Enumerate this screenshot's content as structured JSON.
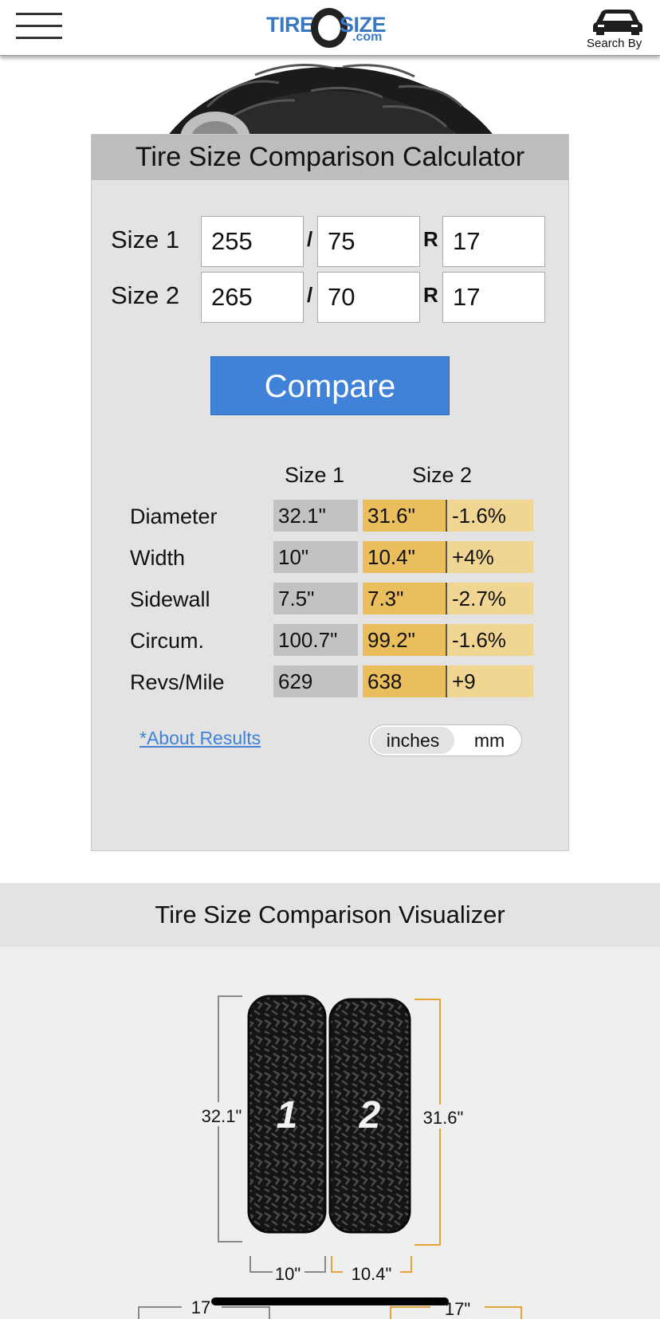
{
  "header": {
    "logo": {
      "text_main_a": "TIRE",
      "text_main_b": "SIZE",
      "text_sub": ".com"
    },
    "search_by_label": "Search By"
  },
  "calculator": {
    "title": "Tire Size Comparison Calculator",
    "size1": {
      "label": "Size 1",
      "width": "255",
      "aspect": "75",
      "rim": "17"
    },
    "size2": {
      "label": "Size 2",
      "width": "265",
      "aspect": "70",
      "rim": "17"
    },
    "separator_slash": "/",
    "separator_r": "R",
    "compare_label": "Compare",
    "columns": {
      "size1": "Size 1",
      "size2": "Size 2"
    },
    "results": [
      {
        "label": "Diameter",
        "size1": "32.1\"",
        "size2": "31.6\"",
        "diff": "-1.6%"
      },
      {
        "label": "Width",
        "size1": "10\"",
        "size2": "10.4\"",
        "diff": "+4%"
      },
      {
        "label": "Sidewall",
        "size1": "7.5\"",
        "size2": "7.3\"",
        "diff": "-2.7%"
      },
      {
        "label": "Circum.",
        "size1": "100.7\"",
        "size2": "99.2\"",
        "diff": "-1.6%"
      },
      {
        "label": "Revs/Mile",
        "size1": "629",
        "size2": "638",
        "diff": "+9"
      }
    ],
    "about_link": "*About Results",
    "units": {
      "inches": "inches",
      "mm": "mm",
      "selected": "inches"
    }
  },
  "visualizer": {
    "title": "Tire Size Comparison Visualizer",
    "tire1_number": "1",
    "tire2_number": "2",
    "tire1_diameter": "32.1\"",
    "tire2_diameter": "31.6\"",
    "tire1_width": "10\"",
    "tire2_width": "10.4\"",
    "rim1": "17",
    "rim2": "17\""
  },
  "colors": {
    "accent_blue": "#3f82d8",
    "size2_orange": "#ebbe5d",
    "diff_light_orange": "#f1d592",
    "size1_gray": "#c2c2c2",
    "bracket_orange": "#e9a23b"
  }
}
